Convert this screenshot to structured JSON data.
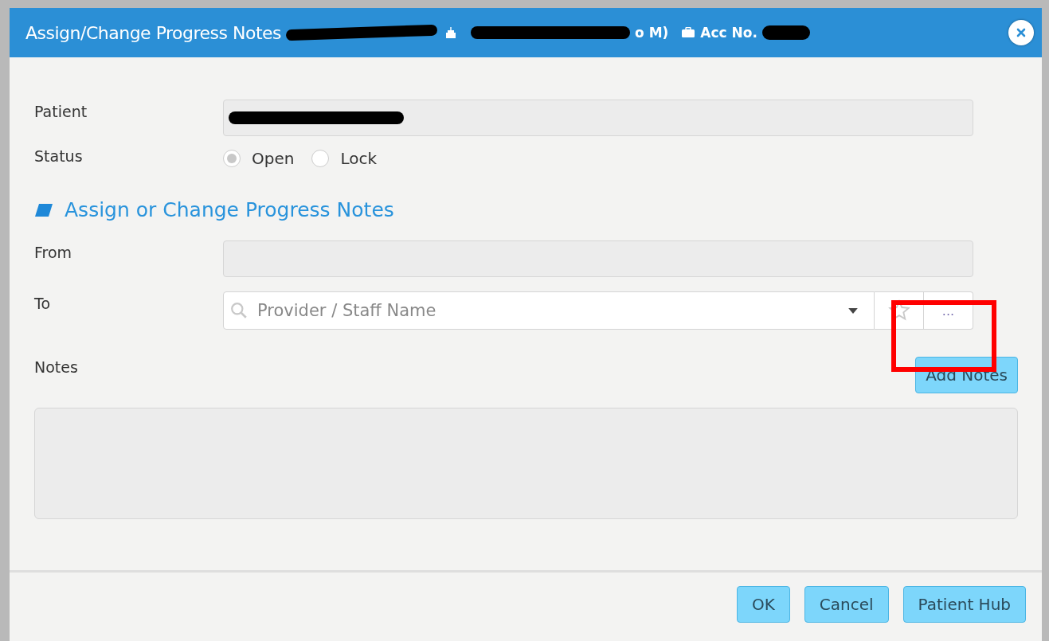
{
  "dialog": {
    "title": "Assign/Change Progress Notes",
    "title_tail": "o M)",
    "account_label": "Acc No."
  },
  "patient": {
    "label": "Patient"
  },
  "status": {
    "label": "Status",
    "options": [
      {
        "label": "Open",
        "selected": true
      },
      {
        "label": "Lock",
        "selected": false
      }
    ]
  },
  "section": {
    "title": "Assign or Change Progress Notes"
  },
  "from": {
    "label": "From"
  },
  "to": {
    "label": "To",
    "placeholder": "Provider / Staff Name",
    "more_button": "..."
  },
  "notes": {
    "label": "Notes",
    "add_button": "Add Notes"
  },
  "buttons": [
    "OK",
    "Cancel",
    "Patient Hub"
  ]
}
